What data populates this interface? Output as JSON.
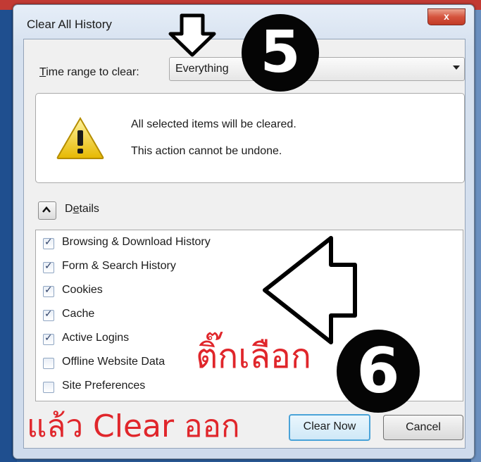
{
  "window": {
    "title": "Clear All History",
    "close_glyph": "x"
  },
  "time_range": {
    "label_first_letter": "T",
    "label_rest": "ime range to clear:",
    "selected": "Everything"
  },
  "warning": {
    "line1": "All selected items will be cleared.",
    "line2": "This action cannot be undone."
  },
  "details": {
    "label_prefix": "D",
    "label_underlined": "e",
    "label_suffix": "tails",
    "expanded": true
  },
  "items": [
    {
      "label": "Browsing & Download History",
      "checked": true
    },
    {
      "label": "Form & Search History",
      "checked": true
    },
    {
      "label": "Cookies",
      "checked": true
    },
    {
      "label": "Cache",
      "checked": true
    },
    {
      "label": "Active Logins",
      "checked": true
    },
    {
      "label": "Offline Website Data",
      "checked": false
    },
    {
      "label": "Site Preferences",
      "checked": false
    }
  ],
  "buttons": {
    "clear_now": "Clear Now",
    "cancel": "Cancel"
  },
  "annotations": {
    "step5": "5",
    "step6": "6",
    "thai_check": "ติ๊กเลือก",
    "thai_clear": "แล้ว Clear ออก",
    "annotation_color": "#e0262b"
  },
  "icons": {
    "warning": "warning-triangle-icon",
    "details_toggle": "chevron-up-icon",
    "close": "close-icon"
  }
}
